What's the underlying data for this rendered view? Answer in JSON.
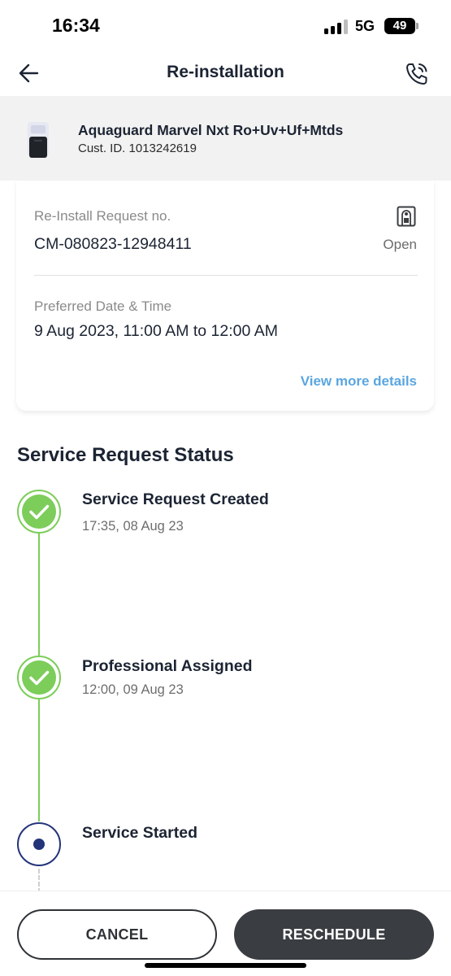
{
  "status_bar": {
    "time": "16:34",
    "network": "5G",
    "battery": "49"
  },
  "header": {
    "title": "Re-installation",
    "back_icon": "arrow-left-icon",
    "call_icon": "phone-call-icon"
  },
  "product": {
    "name": "Aquaguard Marvel Nxt Ro+Uv+Uf+Mtds",
    "customer_id": "Cust. ID. 1013242619"
  },
  "request": {
    "number_label": "Re-Install Request no.",
    "number_value": "CM-080823-12948411",
    "status": "Open",
    "preferred_label": "Preferred Date & Time",
    "preferred_value": "9 Aug 2023, 11:00 AM to 12:00 AM",
    "view_more": "View more details"
  },
  "service_status": {
    "title": "Service Request Status",
    "steps": [
      {
        "title": "Service Request Created",
        "time": "17:35, 08 Aug 23",
        "state": "done"
      },
      {
        "title": "Professional Assigned",
        "time": "12:00, 09 Aug 23",
        "state": "done"
      },
      {
        "title": "Service Started",
        "time": "",
        "state": "current"
      }
    ]
  },
  "actions": {
    "cancel": "CANCEL",
    "reschedule": "RESCHEDULE"
  },
  "colors": {
    "done": "#7ccd5a",
    "current": "#23347a",
    "link": "#5aa6e0",
    "primary_button": "#3a3d41"
  }
}
